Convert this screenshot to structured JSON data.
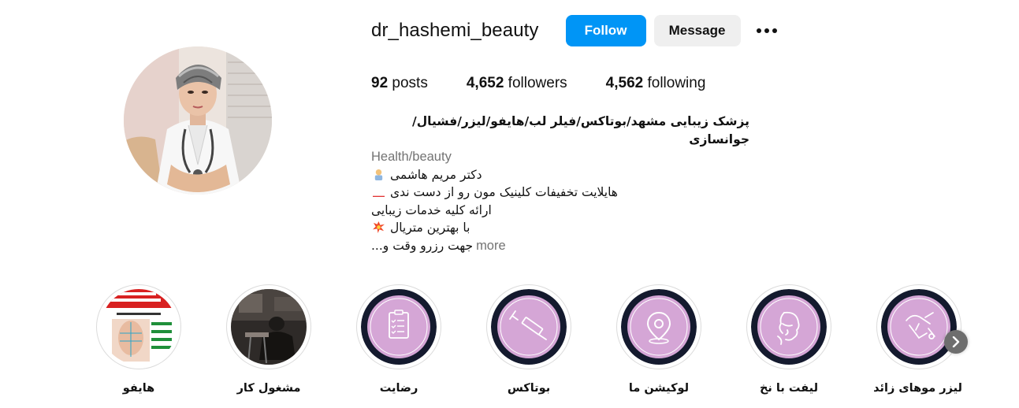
{
  "profile": {
    "username": "dr_hashemi_beauty",
    "follow_label": "Follow",
    "message_label": "Message",
    "more_icon": "more-horizontal-icon"
  },
  "stats": {
    "posts_count": "92",
    "posts_label": "posts",
    "followers_count": "4,652",
    "followers_label": "followers",
    "following_count": "4,562",
    "following_label": "following"
  },
  "bio": {
    "name": "پزشک زیبایی مشهد/بوتاکس/فیلر لب/هایفو/لیزر/فشیال/جوانسازی",
    "category": "Health/beauty",
    "lines": [
      "دکتر مریم هاشمی",
      "هایلایت تخفیفات کلینیک مون رو از دست ندی",
      "ارائه کلیه خدمات زیبایی",
      "با بهترین متریال",
      "جهت رزرو وقت و..."
    ],
    "more_label": "more"
  },
  "highlights": [
    {
      "label": "هایفو",
      "icon": "hifu-flyer-image"
    },
    {
      "label": "مشغول کار",
      "icon": "clinic-photo-image"
    },
    {
      "label": "رضایت",
      "icon": "clipboard-icon"
    },
    {
      "label": "بوتاکس",
      "icon": "syringe-icon"
    },
    {
      "label": "لوکیشن ما",
      "icon": "location-pin-icon"
    },
    {
      "label": "لیفت با نخ",
      "icon": "face-lift-icon"
    },
    {
      "label": "لیزر موهای زائد",
      "icon": "laser-hair-icon"
    }
  ],
  "colors": {
    "follow_bg": "#0095f6",
    "message_bg": "#efefef",
    "highlight_fill": "#d5a6d6",
    "highlight_ring_dark": "#141a2e"
  }
}
